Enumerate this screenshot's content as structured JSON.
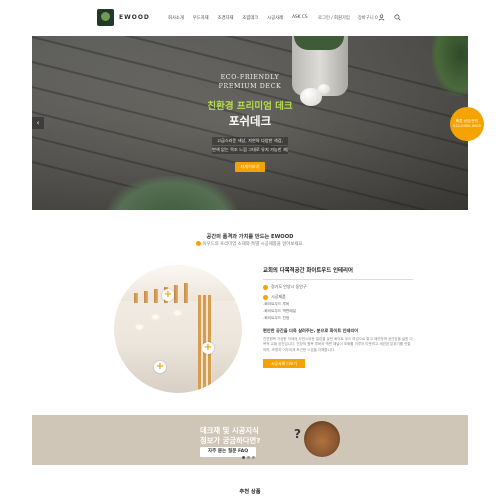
{
  "brand": {
    "name": "EWOOD"
  },
  "nav": {
    "items": [
      "회사소개",
      "우드자재",
      "조경자재",
      "조립데크",
      "시공사례",
      "ASK CS"
    ],
    "util": [
      "로그인 / 회원가입",
      "장바구니 0"
    ]
  },
  "hero": {
    "eng_line1": "ECO-FRIENDLY",
    "eng_line2": "PREMIUM DECK",
    "title_ko": "친환경 프리미엄 데크",
    "product": "포쉬데크",
    "desc_line1": "고급스러운 색상, 자연의 다양한 색감,",
    "desc_line2": "변색 없는 목조 느낌 그대로 유지 가능한 제품",
    "button": "자세히보기",
    "arrow": "‹"
  },
  "floating_badge": {
    "line1": "빠른 상담/문의",
    "line2": "031-0000-0000"
  },
  "intro": {
    "title": "공간의 품격과 가치를 만드는 EWOOD",
    "subtitle": "이우드의 프리미엄 소재와 특별 시공제품을 알아보세요."
  },
  "case": {
    "title": "교회의 다목적공간 화이트우드 인테리어",
    "location": "경기도 안양시 동안구",
    "products_head": "시공제품",
    "products": [
      "-화이트우드 루버",
      "-화이트우드 벽면패널",
      "-화이트우드 천정"
    ],
    "para_head": "편안한 공간을 더욱 살려주는, 분으로 화이트 인테리어",
    "para": "천연원목 가공한 자재의 자연스러운 질감을 살린 화이트 우드 마감으로 밝고 깨끗하며 공간감을 넓힌 다목적 교회 공간입니다. 천장의 원목 루버와 벽면 패널이 조화를 이루어 따뜻하고 세련된 분위기를 연출하며, 조명과 어우러져 포근한 느낌을 더해줍니다.",
    "button": "시공사례 더보기",
    "plus": "+"
  },
  "faq": {
    "line1": "데크재 및 시공지식",
    "line2": "정보가 궁금하다면?",
    "button": "자주 묻는 질문 FAQ",
    "mark": "?"
  },
  "bottom": {
    "title": "추천 상품"
  },
  "colors": {
    "accent": "#f5a300",
    "lime": "#b7dd4e",
    "faq_bg": "#cfc6b8"
  }
}
